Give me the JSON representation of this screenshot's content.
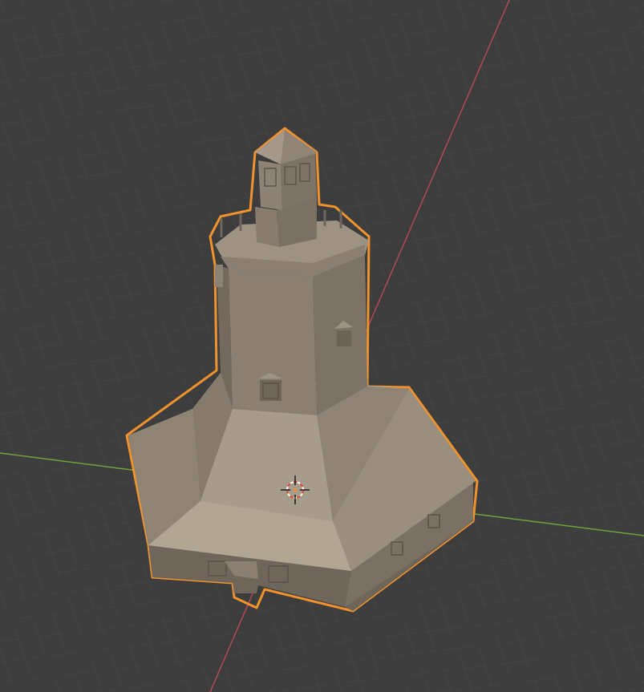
{
  "viewport": {
    "kind": "3d-viewport",
    "mode": "object-mode",
    "colors": {
      "background": "#3d3d3d",
      "grid": "#474747",
      "x_axis": "#b34a55",
      "y_axis": "#6fa33d",
      "selection": "#f0922e",
      "surface_light": "#a89c8c",
      "surface_mid": "#8c8173",
      "surface_dark": "#6f665b"
    }
  },
  "scene": {
    "selected_object": {
      "icon": "mesh-object-icon",
      "selected": true
    },
    "cursor": {
      "icon": "3d-cursor-icon"
    }
  }
}
